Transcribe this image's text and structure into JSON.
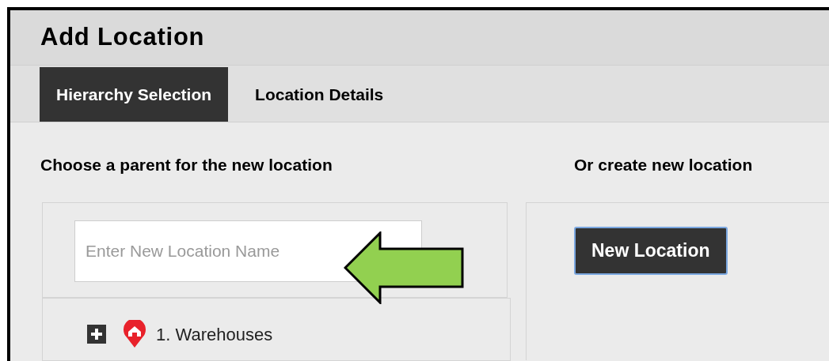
{
  "window": {
    "title": "Add Location"
  },
  "tabs": [
    {
      "label": "Hierarchy Selection",
      "selected": true
    },
    {
      "label": "Location Details",
      "selected": false
    }
  ],
  "parent_section": {
    "heading": "Choose a parent for the new location",
    "search": {
      "placeholder": "Enter New Location Name"
    },
    "tree": [
      {
        "label": "1. Warehouses",
        "expanded": false
      }
    ]
  },
  "create_section": {
    "heading": "Or create new location",
    "button": "New Location"
  }
}
